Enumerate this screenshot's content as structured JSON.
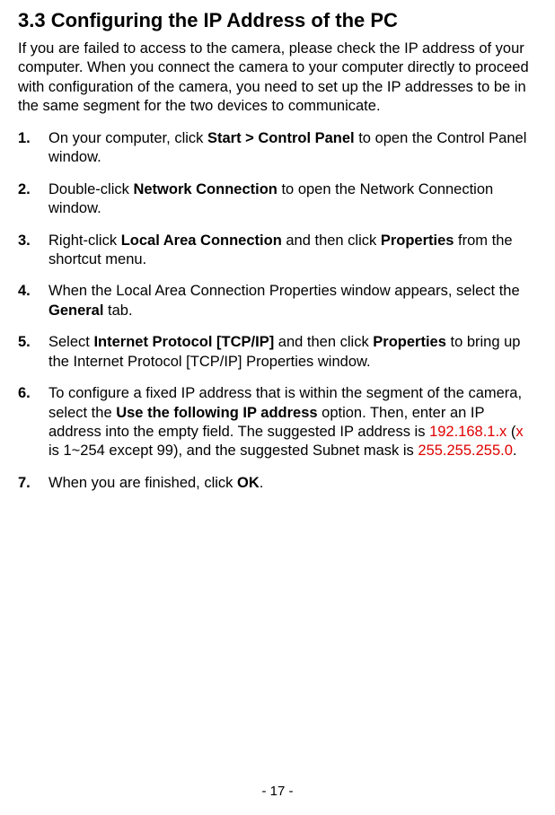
{
  "heading": "3.3  Configuring the IP Address of the PC",
  "intro": "If you are failed to access to the camera, please check the IP address of your computer. When you connect the camera to your computer directly to proceed with configuration of the camera, you need to set up the IP addresses to be in the same segment for the two devices to communicate.",
  "steps": {
    "s1_pre": "On your computer, click ",
    "s1_bold": "Start > Control Panel",
    "s1_post": " to open the Control Panel window.",
    "s2_pre": "Double-click ",
    "s2_bold": "Network Connection",
    "s2_post": " to open the Network Connection window.",
    "s3_pre": "Right-click ",
    "s3_bold1": "Local Area Connection",
    "s3_mid": " and then click ",
    "s3_bold2": "Properties",
    "s3_post": " from the shortcut menu.",
    "s4_pre": "When the Local Area Connection Properties window appears, select the ",
    "s4_bold": "General",
    "s4_post": " tab.",
    "s5_pre": "Select ",
    "s5_bold1": "Internet Protocol [TCP/IP]",
    "s5_mid": " and then click ",
    "s5_bold2": "Properties",
    "s5_post": " to bring up the Internet Protocol [TCP/IP] Properties window.",
    "s6_pre": "To configure a fixed IP address that is within the segment of the camera, select the ",
    "s6_bold": "Use the following IP address",
    "s6_mid1": " option. Then, enter an IP address into the empty field. The suggested IP address is ",
    "s6_red1": "192.168.1.x",
    "s6_mid2": " (",
    "s6_red2": "x",
    "s6_mid3": " is 1~254 except 99), and the suggested Subnet mask is ",
    "s6_red3": "255.255.255.0",
    "s6_post": ".",
    "s7_pre": "When you are finished, click ",
    "s7_bold": "OK",
    "s7_post": "."
  },
  "nums": {
    "n1": "1.",
    "n2": "2.",
    "n3": "3.",
    "n4": "4.",
    "n5": "5.",
    "n6": "6.",
    "n7": "7."
  },
  "footer": "- 17 -"
}
